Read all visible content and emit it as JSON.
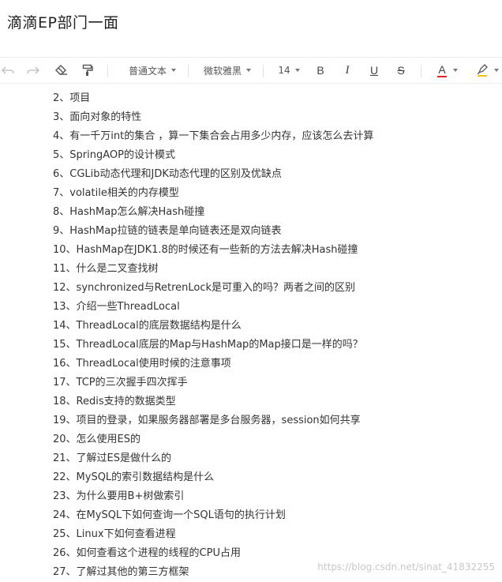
{
  "document": {
    "title": "滴滴EP部门一面"
  },
  "toolbar": {
    "paragraph_style": "普通文本",
    "font_family": "微软雅黑",
    "font_size": "14",
    "bold": "B",
    "italic": "I",
    "underline": "U",
    "strike": "S",
    "text_color_label": "A",
    "text_color": "#e02020",
    "highlight_color": "#f5c400"
  },
  "items": [
    "2、项目",
    "3、面向对象的特性",
    "4、有一千万int的集合 ，算一下集合会占用多少内存，应该怎么去计算",
    "5、SpringAOP的设计模式",
    "6、CGLib动态代理和JDK动态代理的区别及优缺点",
    "7、volatile相关的内存模型",
    "8、HashMap怎么解决Hash碰撞",
    "9、HashMap拉链的链表是单向链表还是双向链表",
    "10、HashMap在JDK1.8的时候还有一些新的方法去解决Hash碰撞",
    "11、什么是二叉查找树",
    "12、synchronized与RetrenLock是可重入的吗？两者之间的区别",
    "13、介绍一些ThreadLocal",
    "14、ThreadLocal的底层数据结构是什么",
    "15、ThreadLocal底层的Map与HashMap的Map接口是一样的吗？",
    "16、ThreadLocal使用时候的注意事项",
    "17、TCP的三次握手四次挥手",
    "18、Redis支持的数据类型",
    "19、项目的登录，如果服务器部署是多台服务器，session如何共享",
    "20、怎么使用ES的",
    "21、了解过ES是做什么的",
    "22、MySQL的索引数据结构是什么",
    "23、为什么要用B+树做索引",
    "24、在MySQL下如何查询一个SQL语句的执行计划",
    "25、Linux下如何查看进程",
    "26、如何查看这个进程的线程的CPU占用",
    "27、了解过其他的第三方框架"
  ],
  "watermark": "https://blog.csdn.net/sinat_41832255"
}
